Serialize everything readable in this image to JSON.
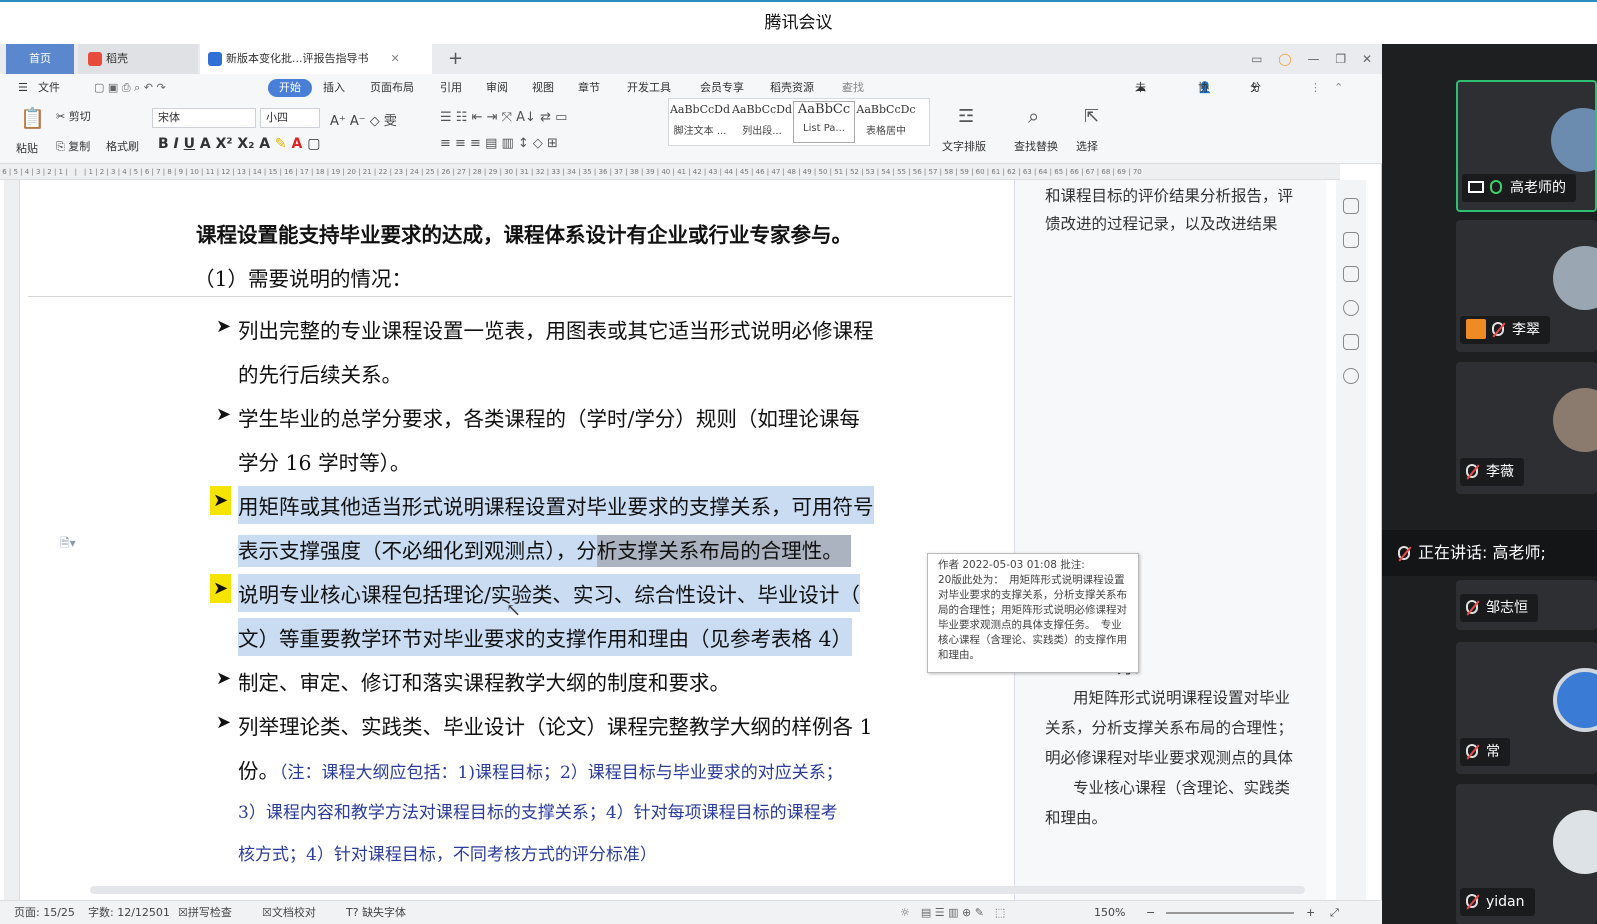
{
  "window_title": "腾讯会议",
  "tabs": {
    "home": "首页",
    "daoke": "稻壳",
    "doc": "新版本变化批...评报告指导书"
  },
  "menu": {
    "file": "文件",
    "start": "开始",
    "insert": "插入",
    "layout": "页面布局",
    "ref": "引用",
    "review": "审阅",
    "view": "视图",
    "chapter": "章节",
    "devtools": "开发工具",
    "member": "会员专享",
    "daoke_res": "稻壳资源",
    "search": "查找命令、搜索模板",
    "unsync": "未同步",
    "collab": "协作",
    "share": "分享"
  },
  "toolbar": {
    "paste": "粘贴",
    "cut": "剪切",
    "copy": "复制",
    "format_painter": "格式刷",
    "font": "宋体",
    "size": "小四",
    "text_layout": "文字排版",
    "find_replace": "查找替换",
    "select": "选择",
    "styles": [
      {
        "preview": "AaBbCcDd",
        "caption": "脚注文本 ..."
      },
      {
        "preview": "AaBbCcDd",
        "caption": "列出段..."
      },
      {
        "preview": "AaBbCc",
        "caption": "List Pa..."
      },
      {
        "preview": "AaBbCcDc",
        "caption": "表格居中"
      }
    ]
  },
  "document": {
    "heading": "课程设置能支持毕业要求的达成，课程体系设计有企业或行业专家参与。",
    "subheading": "（1）需要说明的情况：",
    "bullet1_l1": "列出完整的专业课程设置一览表，用图表或其它适当形式说明必修课程",
    "bullet1_l2": "的先行后续关系。",
    "bullet2_l1": "学生毕业的总学分要求，各类课程的（学时/学分）规则（如理论课每",
    "bullet2_l2": "学分 16 学时等）。",
    "bullet3_l1": "用矩阵或其他适当形式说明课程设置对毕业要求的支撑关系，可用符号",
    "bullet3_l2a": "表示支撑强度（不必细化到观测点），分",
    "bullet3_l2b": "析支撑关系布局的合理性。",
    "bullet4_l1": "说明专业核心课程包括理论/实验类、实习、综合性设计、毕业设计（",
    "bullet4_l2": "文）等重要教学环节对毕业要求的支撑作用和理由（见参考表格 4）",
    "bullet5": "制定、审定、修订和落实课程教学大纲的制度和要求。",
    "bullet6_l1": "列举理论类、实践类、毕业设计（论文）课程完整教学大纲的样例各 1",
    "bullet6_l2a": "份。",
    "note_l1": "（注：课程大纲应包括：1)课程目标；2）课程目标与毕业要求的对应关系；",
    "note_l2": "3）课程内容和教学方法对课程目标的支撑关系；4）针对每项课程目标的课程考",
    "note_l3": "核方式；4）针对课程目标，不同考核方式的评分标准）"
  },
  "comment_panel": {
    "top_l1": "和课程目标的评价结果分析报告，评",
    "top_l2": "馈改进的过程记录，以及改进结果",
    "frag": "为：",
    "b_l1": "用矩阵形式说明课程设置对毕业",
    "b_l2": "关系，分析支撑关系布局的合理性；",
    "b_l3": "明必修课程对毕业要求观测点的具体",
    "b_l4": "专业核心课程（含理论、实践类",
    "b_l5": "和理由。"
  },
  "tooltip": {
    "header": "作者 2022-05-03 01:08 批注:",
    "body": "20版此处为：　用矩阵形式说明课程设置对毕业要求的支撑关系，分析支撑关系布局的合理性；用矩阵形式说明必修课程对毕业要求观测点的具体支撑任务。　专业核心课程（含理论、实践类）的支撑作用和理由。"
  },
  "status": {
    "page": "页面: 15/25",
    "words": "字数: 12/12501",
    "spell": "拼写检查",
    "proof": "文档校对",
    "missing_font": "缺失字体",
    "zoom": "150%"
  },
  "meeting": {
    "participants": [
      "高老师的",
      "李翠",
      "李薇",
      "邹志恒",
      "常",
      "yidan"
    ],
    "speaking": "正在讲话: 高老师;"
  },
  "colors": {
    "accent": "#4a7fd8",
    "selection": "#c9dcf2",
    "bullet_mark": "#f5e300",
    "note_text": "#2c3c9c",
    "meeting_bg": "#1e1f21"
  }
}
